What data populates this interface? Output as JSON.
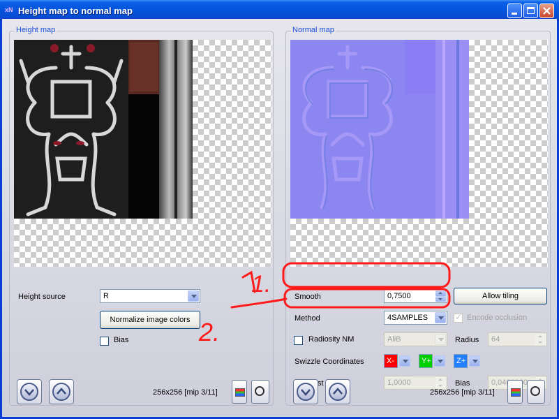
{
  "window": {
    "title": "Height map to normal map",
    "app_icon_text": "xN",
    "buttons": [
      "minimize-icon",
      "maximize-icon",
      "close-icon"
    ]
  },
  "height_panel": {
    "title": "Height map",
    "height_source_label": "Height source",
    "height_source_value": "R",
    "normalize_label": "Normalize image colors",
    "bias_label": "Bias",
    "bias_checked": false,
    "size_text": "256x256 [mip 3/11]"
  },
  "normal_panel": {
    "title": "Normal map",
    "smooth_label": "Smooth",
    "smooth_value": "0,7500",
    "allow_tiling_label": "Allow tiling",
    "method_label": "Method",
    "method_value": "4SAMPLES",
    "encode_occlusion_label": "Encode occlusion",
    "encode_occlusion_checked": true,
    "radiosity_label": "Radiosity NM",
    "radiosity_checked": false,
    "radiosity_value": "AliB",
    "radius_label": "Radius",
    "radius_value": "64",
    "swizzle_label": "Swizzle Coordinates",
    "swizzle": [
      {
        "label": "X-",
        "color": "#ff0000"
      },
      {
        "label": "Y+",
        "color": "#00d000"
      },
      {
        "label": "Z+",
        "color": "#2080ff"
      }
    ],
    "contrast_label": "Contrast",
    "contrast_value": "1,0000",
    "bias_label": "Bias",
    "bias_value": "0,0400000",
    "size_text": "256x256 [mip 3/11]"
  },
  "annotations": {
    "one": "1.",
    "two": "2.",
    "color": "#ff1a1a"
  }
}
